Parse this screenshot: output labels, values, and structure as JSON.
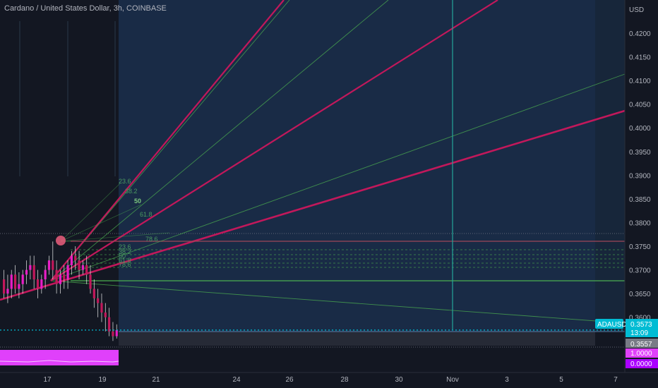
{
  "header": {
    "title": "Cardano / United States Dollar, 3h, COINBASE"
  },
  "colors": {
    "background": "#131722",
    "projection_zone": "#1b2f4c",
    "candle_up": "#e91ec6",
    "candle_down": "#e91ec6",
    "fan_line": "#4caf50",
    "fan_strong": "#c2185b",
    "price_line": "#00bcd4",
    "level_line": "#4caf50",
    "resistance_line": "#c2185b",
    "indicator": "#e040fb"
  },
  "chart_data": {
    "type": "candlestick",
    "symbol": "ADAUSD",
    "currency": "USD",
    "y_ticks": [
      "0.4200",
      "0.4150",
      "0.4100",
      "0.4050",
      "0.4000",
      "0.3950",
      "0.3900",
      "0.3850",
      "0.3800",
      "0.3750",
      "0.3700",
      "0.3650",
      "0.3600"
    ],
    "y_range": [
      0.354,
      0.427
    ],
    "x_ticks": [
      "17",
      "19",
      "21",
      "24",
      "26",
      "28",
      "30",
      "Nov",
      "3",
      "5",
      "7"
    ],
    "last_price": "0.3573",
    "countdown": "13:09",
    "secondary_price": "0.3557",
    "indicator_values": [
      "1.0000",
      "0.0000"
    ],
    "fib_fan_labels": [
      "23.6",
      "38.2",
      "50",
      "61.8",
      "78.6"
    ],
    "fib_retracement_labels": [
      "23.6",
      "38.2",
      "50",
      "61.8",
      "78.6"
    ],
    "candles": [
      [
        0.368,
        0.37,
        0.365,
        0.364
      ],
      [
        0.365,
        0.369,
        0.366,
        0.363
      ],
      [
        0.366,
        0.37,
        0.369,
        0.364
      ],
      [
        0.369,
        0.371,
        0.366,
        0.365
      ],
      [
        0.366,
        0.3695,
        0.367,
        0.364
      ],
      [
        0.367,
        0.37,
        0.369,
        0.365
      ],
      [
        0.369,
        0.372,
        0.37,
        0.367
      ],
      [
        0.37,
        0.373,
        0.371,
        0.368
      ],
      [
        0.371,
        0.373,
        0.368,
        0.366
      ],
      [
        0.368,
        0.37,
        0.366,
        0.364
      ],
      [
        0.366,
        0.369,
        0.368,
        0.365
      ],
      [
        0.368,
        0.371,
        0.37,
        0.366
      ],
      [
        0.37,
        0.373,
        0.372,
        0.369
      ],
      [
        0.372,
        0.376,
        0.37,
        0.368
      ],
      [
        0.37,
        0.372,
        0.367,
        0.365
      ],
      [
        0.367,
        0.37,
        0.369,
        0.365
      ],
      [
        0.369,
        0.371,
        0.368,
        0.366
      ],
      [
        0.368,
        0.372,
        0.371,
        0.366
      ],
      [
        0.371,
        0.374,
        0.373,
        0.369
      ],
      [
        0.373,
        0.375,
        0.372,
        0.37
      ],
      [
        0.372,
        0.374,
        0.37,
        0.368
      ],
      [
        0.37,
        0.372,
        0.371,
        0.369
      ],
      [
        0.371,
        0.373,
        0.369,
        0.367
      ],
      [
        0.369,
        0.371,
        0.366,
        0.365
      ],
      [
        0.366,
        0.368,
        0.364,
        0.362
      ],
      [
        0.364,
        0.366,
        0.363,
        0.36
      ],
      [
        0.363,
        0.365,
        0.361,
        0.359
      ],
      [
        0.361,
        0.363,
        0.36,
        0.357
      ],
      [
        0.36,
        0.362,
        0.357,
        0.356
      ],
      [
        0.357,
        0.359,
        0.356,
        0.355
      ],
      [
        0.356,
        0.3585,
        0.3573,
        0.3555
      ]
    ]
  }
}
